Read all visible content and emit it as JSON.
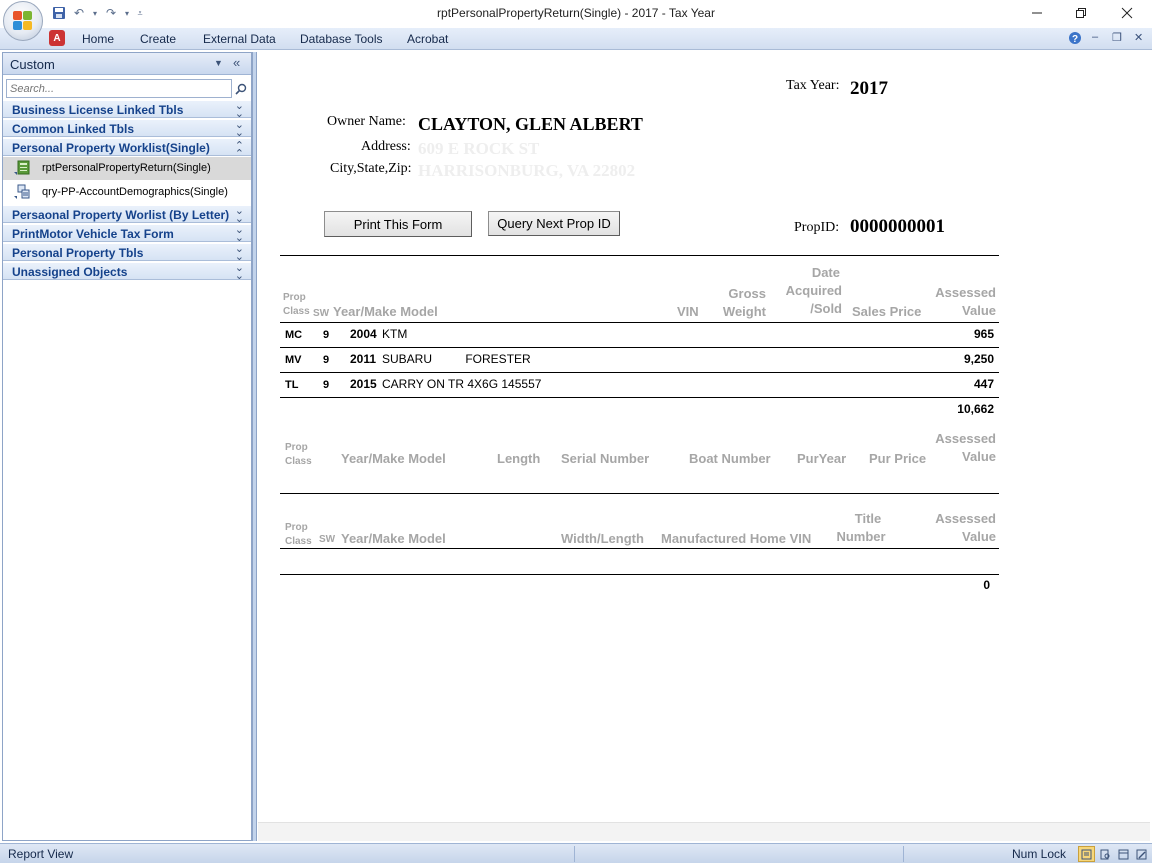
{
  "window": {
    "title": "rptPersonalPropertyReturn(Single)  -  2017 - Tax Year"
  },
  "ribbon": {
    "tabs": [
      "Home",
      "Create",
      "External Data",
      "Database Tools",
      "Acrobat"
    ]
  },
  "nav": {
    "header": "Custom",
    "search_placeholder": "Search...",
    "groups": [
      {
        "label": "Business License Linked Tbls"
      },
      {
        "label": "Common Linked Tbls"
      },
      {
        "label": "Personal Property Worklist(Single)"
      },
      {
        "label": "Persaonal Property Worlist (By Letter)"
      },
      {
        "label": "PrintMotor Vehicle Tax Form"
      },
      {
        "label": "Personal Property Tbls"
      },
      {
        "label": "Unassigned Objects"
      }
    ],
    "objects": [
      {
        "label": "rptPersonalPropertyReturn(Single)",
        "icon": "report-icon"
      },
      {
        "label": "qry-PP-AccountDemographics(Single)",
        "icon": "query-icon"
      }
    ]
  },
  "report": {
    "tax_year_label": "Tax Year:",
    "tax_year": "2017",
    "owner_label": "Owner Name:",
    "owner_name": "CLAYTON, GLEN ALBERT",
    "address_label": "Address:",
    "address": "609 E ROCK ST",
    "csz_label": "City,State,Zip:",
    "csz": "HARRISONBURG, VA  22802",
    "print_button": "Print This Form",
    "query_button": "Query Next Prop ID",
    "propid_label": "PropID:",
    "propid": "0000000001",
    "vehicles": {
      "headers": {
        "prop": "Prop",
        "class": "Class",
        "sw": "SW",
        "year_make_model": "Year/Make Model",
        "vin": "VIN",
        "gross": "Gross",
        "weight": "Weight",
        "date": "Date",
        "acquired": "Acquired",
        "sold": "/Sold",
        "sales_price": "Sales Price",
        "assessed": "Assessed",
        "value": "Value"
      },
      "rows": [
        {
          "class": "MC",
          "sw": "9",
          "year": "2004",
          "make_model": "KTM",
          "value": "965"
        },
        {
          "class": "MV",
          "sw": "9",
          "year": "2011",
          "make_model": "SUBARU          FORESTER",
          "value": "9,250"
        },
        {
          "class": "TL",
          "sw": "9",
          "year": "2015",
          "make_model": "CARRY ON TR 4X6G 145557",
          "value": "447"
        }
      ],
      "total": "10,662"
    },
    "boats": {
      "headers": {
        "prop": "Prop",
        "class": "Class",
        "year_make_model": "Year/Make Model",
        "length": "Length",
        "serial": "Serial Number",
        "boat_number": "Boat Number",
        "pur_year": "PurYear",
        "pur_price": "Pur Price",
        "assessed": "Assessed",
        "value": "Value"
      }
    },
    "mobile_homes": {
      "headers": {
        "prop": "Prop",
        "class": "Class",
        "sw": "SW",
        "year_make_model": "Year/Make Model",
        "width_length": "Width/Length",
        "vin": "Manufactured Home VIN",
        "title": "Title",
        "number": "Number",
        "assessed": "Assessed",
        "value": "Value"
      },
      "total": "0"
    }
  },
  "status": {
    "left": "Report View",
    "numlock": "Num Lock"
  }
}
